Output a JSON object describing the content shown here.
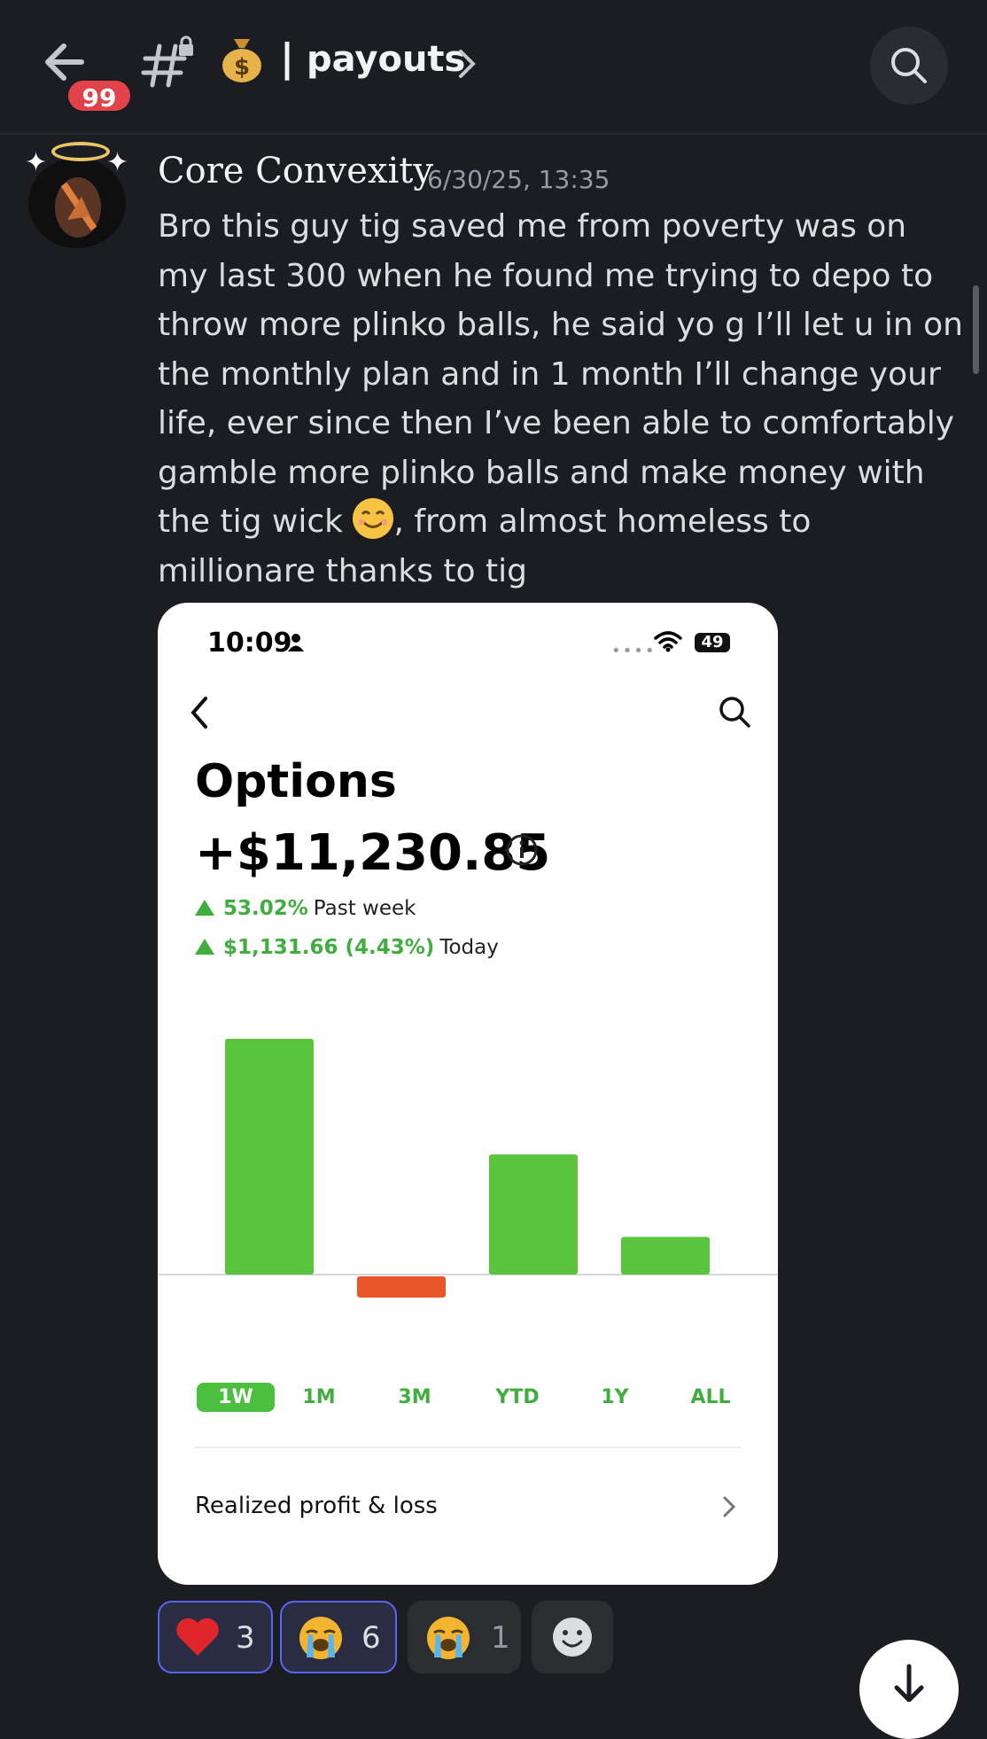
{
  "header": {
    "back_label": "back",
    "unread_badge": "99",
    "separator": "|",
    "channel_name": "payouts"
  },
  "message": {
    "author": "Core Convexity",
    "timestamp": "6/30/25, 13:35",
    "text_before_emoji": "Bro this guy tig saved me from poverty was on my last 300 when he found me trying to depo to throw more plinko balls, he said yo g I’ll let u in on the monthly plan and in 1 month I’ll change your life, ever since then I’ve been able to comfortably gamble more plinko balls and make money with the tig wick ",
    "text_after_emoji": ", from almost homeless to millionare thanks to tig"
  },
  "attachment": {
    "status_time": "10:09",
    "battery": "49",
    "title": "Options",
    "amount": "+$11,230.85",
    "stat_week_value": "53.02%",
    "stat_week_label": "Past week",
    "stat_today_value": "$1,131.66 (4.43%)",
    "stat_today_label": "Today",
    "timeframes": [
      "1W",
      "1M",
      "3M",
      "YTD",
      "1Y",
      "ALL"
    ],
    "selected_timeframe": "1W",
    "realized_label": "Realized profit & loss",
    "colors": {
      "positive": "#5ac43f",
      "negative": "#e8562a"
    }
  },
  "chart_data": {
    "type": "bar",
    "categories": [
      "",
      "",
      "",
      ""
    ],
    "values": [
      100,
      -9,
      51,
      16
    ],
    "colors": [
      "#5ac43f",
      "#e8562a",
      "#5ac43f",
      "#5ac43f"
    ]
  },
  "reactions": [
    {
      "emoji": "red-heart",
      "count": "3",
      "active": true
    },
    {
      "emoji": "loudly-crying-face",
      "count": "6",
      "active": true
    },
    {
      "emoji": "loudly-crying-face",
      "count": "1",
      "active": false
    }
  ]
}
